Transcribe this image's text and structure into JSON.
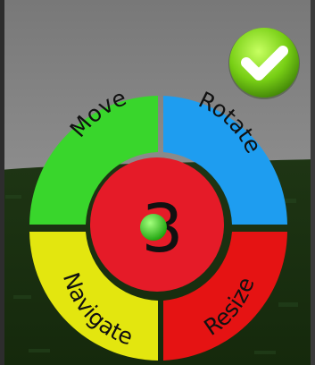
{
  "menu": {
    "move_label": "Move",
    "rotate_label": "Rotate",
    "navigate_label": "Navigate",
    "resize_label": "Resize",
    "center_value": "3"
  },
  "icons": {
    "confirm": "check-icon",
    "center_dot": "green-dot-icon"
  },
  "colors": {
    "move": "#39d62c",
    "rotate": "#1e9df0",
    "navigate": "#e3e60f",
    "resize": "#e51313",
    "center": "#e51b28",
    "confirm": "#7bd318"
  }
}
